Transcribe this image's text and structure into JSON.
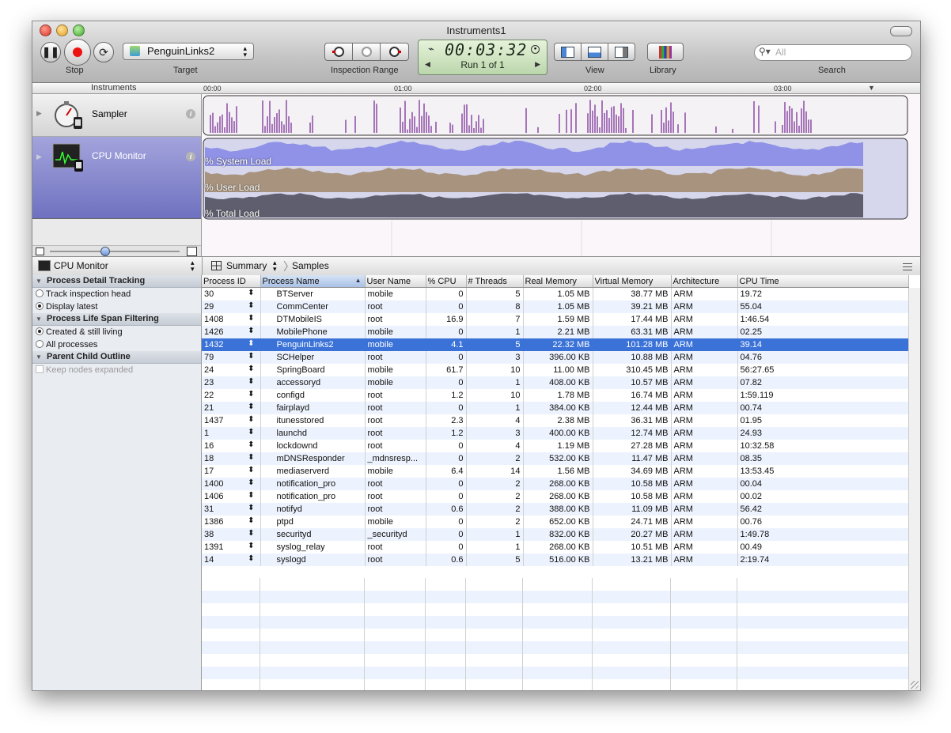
{
  "window": {
    "title": "Instruments1"
  },
  "toolbar": {
    "stop_label": "Stop",
    "target_label": "Target",
    "target_value": "PenguinLinks2",
    "inspection_range_label": "Inspection Range",
    "timer": "00:03:32",
    "run_label": "Run 1 of 1",
    "view_label": "View",
    "library_label": "Library",
    "search_placeholder": "All",
    "search_label": "Search"
  },
  "ruler": {
    "heading": "Instruments",
    "ticks": [
      "00:00",
      "01:00",
      "02:00",
      "03:00"
    ]
  },
  "instruments": [
    {
      "name": "Sampler"
    },
    {
      "name": "CPU Monitor",
      "series": [
        "% System Load",
        "% User Load",
        "% Total Load"
      ]
    }
  ],
  "nav": {
    "instrument": "CPU Monitor",
    "view": "Summary",
    "crumb": "Samples"
  },
  "sidebar": {
    "sections": [
      {
        "title": "Process Detail Tracking",
        "options": [
          "Track inspection head",
          "Display latest"
        ],
        "selected": 1
      },
      {
        "title": "Process Life Span Filtering",
        "options": [
          "Created & still living",
          "All processes"
        ],
        "selected": 0
      },
      {
        "title": "Parent Child Outline",
        "checkbox": "Keep nodes expanded"
      }
    ]
  },
  "table": {
    "columns": [
      "Process ID",
      "Process Name",
      "User Name",
      "% CPU",
      "# Threads",
      "Real Memory",
      "Virtual Memory",
      "Architecture",
      "CPU Time"
    ],
    "sorted_column": "Process Name",
    "selected_pid": "1432",
    "rows": [
      [
        "30",
        "BTServer",
        "mobile",
        "0",
        "5",
        "1.05 MB",
        "38.77 MB",
        "ARM",
        "19.72"
      ],
      [
        "29",
        "CommCenter",
        "root",
        "0",
        "8",
        "1.05 MB",
        "39.21 MB",
        "ARM",
        "55.04"
      ],
      [
        "1408",
        "DTMobileIS",
        "root",
        "16.9",
        "7",
        "1.59 MB",
        "17.44 MB",
        "ARM",
        "1:46.54"
      ],
      [
        "1426",
        "MobilePhone",
        "mobile",
        "0",
        "1",
        "2.21 MB",
        "63.31 MB",
        "ARM",
        "02.25"
      ],
      [
        "1432",
        "PenguinLinks2",
        "mobile",
        "4.1",
        "5",
        "22.32 MB",
        "101.28 MB",
        "ARM",
        "39.14"
      ],
      [
        "79",
        "SCHelper",
        "root",
        "0",
        "3",
        "396.00 KB",
        "10.88 MB",
        "ARM",
        "04.76"
      ],
      [
        "24",
        "SpringBoard",
        "mobile",
        "61.7",
        "10",
        "11.00 MB",
        "310.45 MB",
        "ARM",
        "56:27.65"
      ],
      [
        "23",
        "accessoryd",
        "mobile",
        "0",
        "1",
        "408.00 KB",
        "10.57 MB",
        "ARM",
        "07.82"
      ],
      [
        "22",
        "configd",
        "root",
        "1.2",
        "10",
        "1.78 MB",
        "16.74 MB",
        "ARM",
        "1:59.119"
      ],
      [
        "21",
        "fairplayd",
        "root",
        "0",
        "1",
        "384.00 KB",
        "12.44 MB",
        "ARM",
        "00.74"
      ],
      [
        "1437",
        "itunesstored",
        "root",
        "2.3",
        "4",
        "2.38 MB",
        "36.31 MB",
        "ARM",
        "01.95"
      ],
      [
        "1",
        "launchd",
        "root",
        "1.2",
        "3",
        "400.00 KB",
        "12.74 MB",
        "ARM",
        "24.93"
      ],
      [
        "16",
        "lockdownd",
        "root",
        "0",
        "4",
        "1.19 MB",
        "27.28 MB",
        "ARM",
        "10:32.58"
      ],
      [
        "18",
        "mDNSResponder",
        "_mdnsresp...",
        "0",
        "2",
        "532.00 KB",
        "11.47 MB",
        "ARM",
        "08.35"
      ],
      [
        "17",
        "mediaserverd",
        "mobile",
        "6.4",
        "14",
        "1.56 MB",
        "34.69 MB",
        "ARM",
        "13:53.45"
      ],
      [
        "1400",
        "notification_pro",
        "root",
        "0",
        "2",
        "268.00 KB",
        "10.58 MB",
        "ARM",
        "00.04"
      ],
      [
        "1406",
        "notification_pro",
        "root",
        "0",
        "2",
        "268.00 KB",
        "10.58 MB",
        "ARM",
        "00.02"
      ],
      [
        "31",
        "notifyd",
        "root",
        "0.6",
        "2",
        "388.00 KB",
        "11.09 MB",
        "ARM",
        "56.42"
      ],
      [
        "1386",
        "ptpd",
        "mobile",
        "0",
        "2",
        "652.00 KB",
        "24.71 MB",
        "ARM",
        "00.76"
      ],
      [
        "38",
        "securityd",
        "_securityd",
        "0",
        "1",
        "832.00 KB",
        "20.27 MB",
        "ARM",
        "1:49.78"
      ],
      [
        "1391",
        "syslog_relay",
        "root",
        "0",
        "1",
        "268.00 KB",
        "10.51 MB",
        "ARM",
        "00.49"
      ],
      [
        "14",
        "syslogd",
        "root",
        "0.6",
        "5",
        "516.00 KB",
        "13.21 MB",
        "ARM",
        "2:19.74"
      ]
    ]
  }
}
